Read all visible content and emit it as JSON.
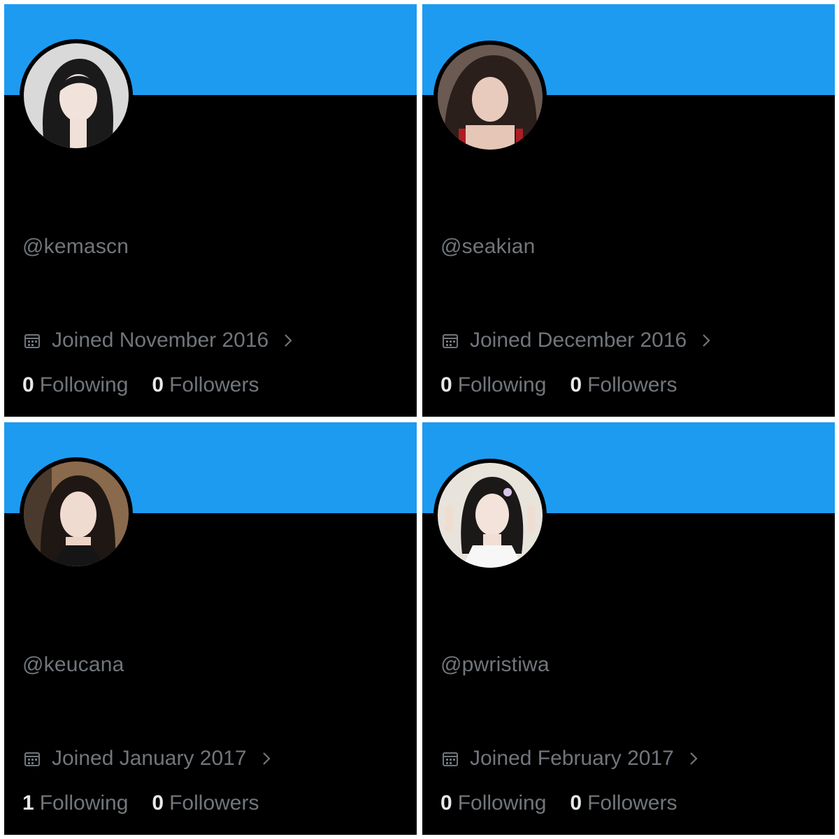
{
  "colors": {
    "banner": "#1d9bf0",
    "background": "#000000",
    "muted_text": "#71767b",
    "bright_text": "#e7e9ea"
  },
  "icons": {
    "joined": "calendar-icon",
    "more": "chevron-right-icon"
  },
  "profiles": [
    {
      "handle": "@kemascn",
      "joined": "Joined November 2016",
      "following_count": "0",
      "following_label": "Following",
      "followers_count": "0",
      "followers_label": "Followers"
    },
    {
      "handle": "@seakian",
      "joined": "Joined December 2016",
      "following_count": "0",
      "following_label": "Following",
      "followers_count": "0",
      "followers_label": "Followers"
    },
    {
      "handle": "@keucana",
      "joined": "Joined January 2017",
      "following_count": "1",
      "following_label": "Following",
      "followers_count": "0",
      "followers_label": "Followers"
    },
    {
      "handle": "@pwristiwa",
      "joined": "Joined February 2017",
      "following_count": "0",
      "following_label": "Following",
      "followers_count": "0",
      "followers_label": "Followers"
    }
  ]
}
